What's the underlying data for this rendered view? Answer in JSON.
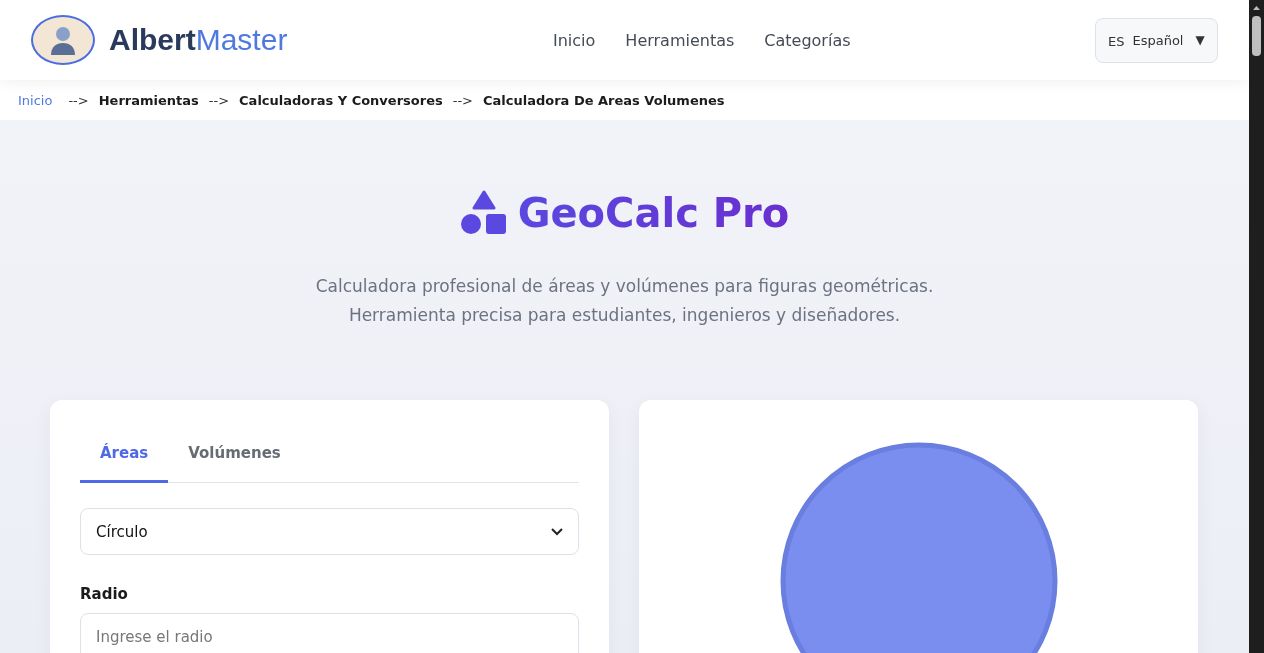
{
  "header": {
    "brand_dark": "Albert",
    "brand_accent": "Master",
    "nav": [
      "Inicio",
      "Herramientas",
      "Categorías"
    ],
    "language": {
      "code": "ES",
      "label": "Español",
      "caret": "▼"
    }
  },
  "breadcrumb": {
    "separator": "-->",
    "items": [
      {
        "label": "Inicio",
        "kind": "link"
      },
      {
        "label": "Herramientas",
        "kind": "current"
      },
      {
        "label": "Calculadoras Y Conversores",
        "kind": "current"
      },
      {
        "label": "Calculadora De Areas Volumenes",
        "kind": "current"
      }
    ]
  },
  "hero": {
    "title": "GeoCalc Pro",
    "subtitle_lines": [
      "Calculadora profesional de áreas y volúmenes para figuras geométricas.",
      "Herramienta precisa para estudiantes, ingenieros y diseñadores."
    ]
  },
  "calculator": {
    "tabs": [
      {
        "label": "Áreas",
        "selected": true
      },
      {
        "label": "Volúmenes",
        "selected": false
      }
    ],
    "shape_select": {
      "value": "Círculo"
    },
    "fields": [
      {
        "label": "Radio",
        "placeholder": "Ingrese el radio"
      }
    ]
  },
  "preview": {
    "kind": "circle"
  }
}
